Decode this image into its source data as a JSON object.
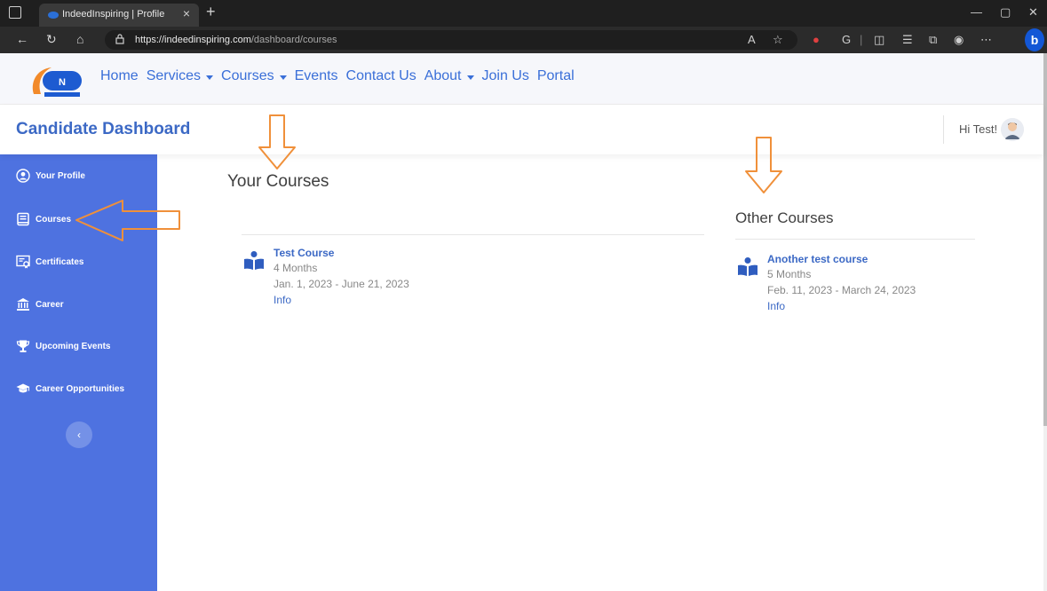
{
  "browser": {
    "tab_title": "IndeedInspiring | Profile",
    "tab_close": "×",
    "new_tab": "+",
    "url_host": "https://indeedinspiring.com",
    "url_path": "/dashboard/courses",
    "window_controls": [
      "—",
      "▢",
      "✕"
    ]
  },
  "nav": {
    "links": [
      {
        "label": "Home",
        "dropdown": false
      },
      {
        "label": "Services",
        "dropdown": true
      },
      {
        "label": "Courses",
        "dropdown": true
      },
      {
        "label": "Events",
        "dropdown": false
      },
      {
        "label": "Contact Us",
        "dropdown": false
      },
      {
        "label": "About",
        "dropdown": true
      },
      {
        "label": "Join Us",
        "dropdown": false
      },
      {
        "label": "Portal",
        "dropdown": false
      }
    ]
  },
  "header": {
    "title": "Candidate Dashboard",
    "greeting": "Hi Test!"
  },
  "sidebar": {
    "items": [
      {
        "label": "Your Profile",
        "icon": "user-circle-icon"
      },
      {
        "label": "Courses",
        "icon": "book-icon"
      },
      {
        "label": "Certificates",
        "icon": "certificate-icon"
      },
      {
        "label": "Career",
        "icon": "bank-icon"
      },
      {
        "label": "Upcoming Events",
        "icon": "trophy-icon"
      },
      {
        "label": "Career Opportunities",
        "icon": "graduation-cap-icon"
      }
    ],
    "collapse_label": "‹"
  },
  "main": {
    "your_courses": {
      "title": "Your Courses",
      "courses": [
        {
          "name": "Test Course",
          "duration": "4 Months",
          "dates": "Jan. 1, 2023 - June 21, 2023",
          "info": "Info"
        }
      ]
    },
    "other_courses": {
      "title": "Other Courses",
      "courses": [
        {
          "name": "Another test course",
          "duration": "5 Months",
          "dates": "Feb. 11, 2023 - March 24, 2023",
          "info": "Info"
        }
      ]
    }
  },
  "colors": {
    "brand_blue": "#3c69c5",
    "sidebar_bg": "#4e72e0",
    "annotation": "#f0903a"
  }
}
